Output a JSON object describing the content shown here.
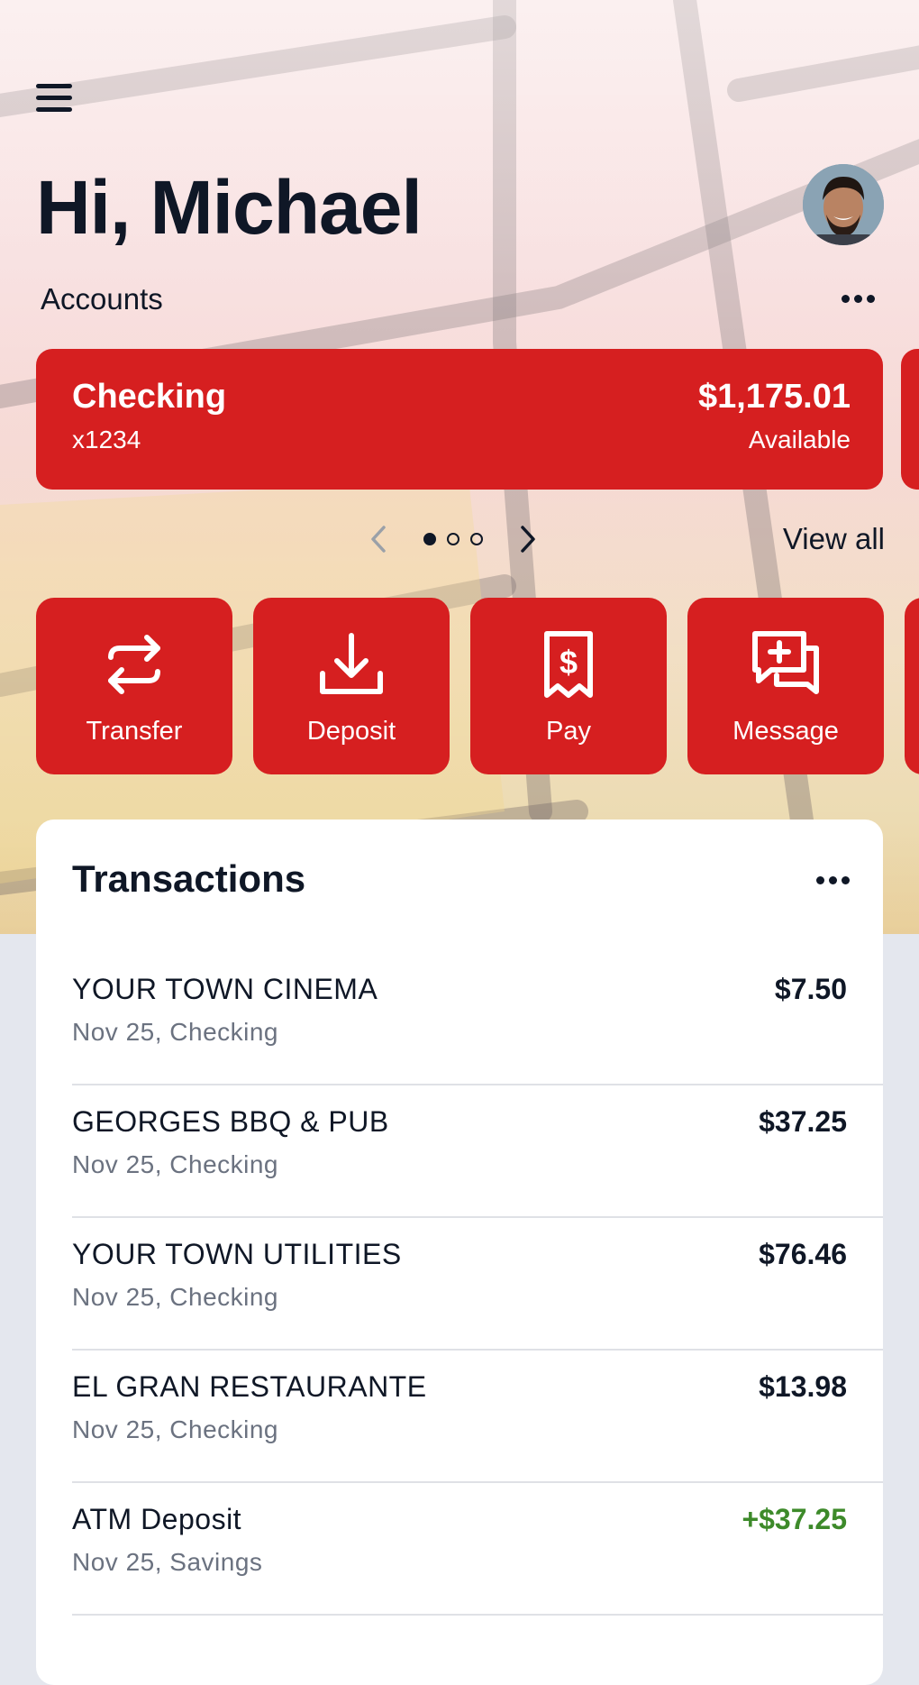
{
  "header": {
    "greeting": "Hi, Michael",
    "menu_icon": "hamburger-menu-icon",
    "avatar": "user-avatar-photo"
  },
  "accounts": {
    "label": "Accounts",
    "more_icon": "more-horizontal-icon",
    "card": {
      "name": "Checking",
      "number": "x1234",
      "balance": "$1,175.01",
      "balance_label": "Available"
    },
    "pager": {
      "current_page": 1,
      "total_pages": 3
    },
    "view_all": "View all"
  },
  "actions": [
    {
      "label": "Transfer",
      "icon": "transfer-arrows-icon"
    },
    {
      "label": "Deposit",
      "icon": "download-tray-icon"
    },
    {
      "label": "Pay",
      "icon": "receipt-dollar-icon"
    },
    {
      "label": "Message",
      "icon": "chat-add-icon"
    }
  ],
  "transactions": {
    "title": "Transactions",
    "items": [
      {
        "name": "YOUR TOWN CINEMA",
        "meta": "Nov 25, Checking",
        "amount": "$7.50",
        "credit": false
      },
      {
        "name": "GEORGES BBQ & PUB",
        "meta": "Nov 25, Checking",
        "amount": "$37.25",
        "credit": false
      },
      {
        "name": "YOUR TOWN UTILITIES",
        "meta": "Nov 25, Checking",
        "amount": "$76.46",
        "credit": false
      },
      {
        "name": "EL GRAN RESTAURANTE",
        "meta": "Nov 25, Checking",
        "amount": "$13.98",
        "credit": false
      },
      {
        "name": "ATM Deposit",
        "meta": "Nov 25, Savings",
        "amount": "+$37.25",
        "credit": true
      }
    ]
  },
  "colors": {
    "brand_red": "#d61f20",
    "text_dark": "#0f1726",
    "text_muted": "#6b7280",
    "credit_green": "#3d8a2a",
    "page_bg": "#e4e7ee"
  }
}
